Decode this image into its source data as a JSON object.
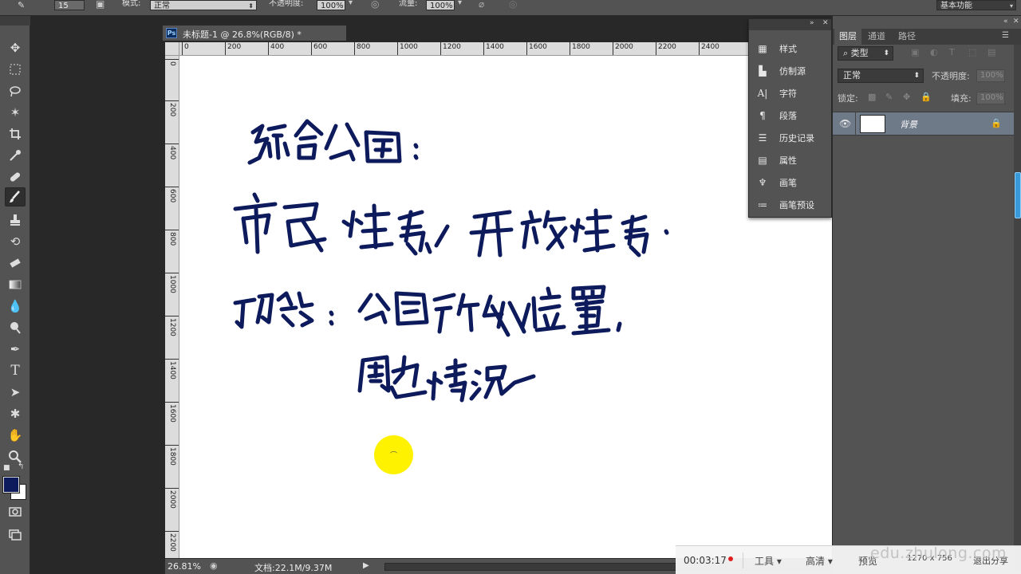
{
  "options_bar": {
    "brush_size": "15",
    "mode_label": "模式:",
    "mode_value": "正常",
    "opacity_label": "不透明度:",
    "opacity_value": "100%",
    "flow_label": "流量:",
    "flow_value": "100%",
    "workspace": "基本功能"
  },
  "document": {
    "tab_title": "未标题-1 @ 26.8%(RGB/8) *",
    "ps_badge": "Ps",
    "h_ruler": [
      "0",
      "200",
      "400",
      "600",
      "800",
      "1000",
      "1200",
      "1400",
      "1600",
      "1800",
      "2000",
      "2200",
      "2400"
    ],
    "v_ruler": [
      "0",
      "200",
      "400",
      "600",
      "800",
      "1000",
      "1200",
      "1400",
      "1600",
      "1800",
      "2000",
      "2200"
    ],
    "ink_color": "#0d1a5c",
    "handwriting": [
      "综合公园:",
      "市民性质, 开放性质.",
      "功能: 公园所处位置,",
      "周边情况"
    ]
  },
  "status_bar": {
    "zoom": "26.81%",
    "doc_info": "文档:22.1M/9.37M"
  },
  "float_panel": {
    "items": [
      "样式",
      "仿制源",
      "字符",
      "段落",
      "历史记录",
      "属性",
      "画笔",
      "画笔预设"
    ]
  },
  "layers_panel": {
    "tabs": [
      "图层",
      "通道",
      "路径"
    ],
    "filter_label": "类型",
    "blend_mode": "正常",
    "opacity_label": "不透明度:",
    "opacity_value": "100%",
    "lock_label": "锁定:",
    "fill_label": "填充:",
    "fill_value": "100%",
    "layer_name": "背景"
  },
  "recorder": {
    "time": "00:03:17",
    "tools": "工具",
    "quality": "高清",
    "preview": "预览",
    "resolution": "1270 x 756",
    "exit": "退出分享"
  },
  "watermark": "edu.zhulong.com",
  "colors": {
    "foreground": "#0d1a5c",
    "background": "#ffffff",
    "highlight": "#fef200"
  }
}
